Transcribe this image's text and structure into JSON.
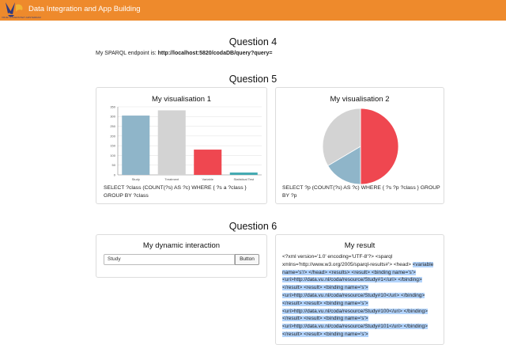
{
  "header": {
    "title": "Data Integration and App Building",
    "logo_caption": "VRIJE UNIVERSITEIT AMSTERDAM"
  },
  "q4": {
    "heading": "Question 4",
    "endpoint_label": "My SPARQL endpoint is:",
    "endpoint_url": "http://localhost:5820/codaDB/query?query="
  },
  "q5": {
    "heading": "Question 5",
    "vis1": {
      "title": "My visualisation 1",
      "query": "SELECT ?class (COUNT(?s) AS ?c) WHERE { ?s a ?class } GROUP BY ?class"
    },
    "vis2": {
      "title": "My visualisation 2",
      "query": "SELECT ?p (COUNT(?s) AS ?c) WHERE { ?s ?p ?class } GROUP BY ?p"
    }
  },
  "q6": {
    "heading": "Question 6",
    "interaction": {
      "title": "My dynamic interaction",
      "input_value": "Study",
      "button_label": "Button"
    },
    "result": {
      "title": "My result",
      "text_plain": "<?xml version='1.0' encoding='UTF-8'?> <sparql xmlns='http://www.w3.org/2005/sparql-results#'> <head> ",
      "text_selected": "<variable name='s'/> </head> <results> <result> <binding name='s'> <uri>http://data.vu.nl/coda/resource/Study#1</uri> </binding> </result> <result> <binding name='s'> <uri>http://data.vu.nl/coda/resource/Study#10</uri> </binding> </result> <result> <binding name='s'> <uri>http://data.vu.nl/coda/resource/Study#100</uri> </binding> </result> <result> <binding name='s'> <uri>http://data.vu.nl/coda/resource/Study#101</uri> </binding> </result> <result> <binding name='s'>"
    }
  },
  "chart_data": [
    {
      "type": "bar",
      "categories": [
        "Study",
        "Treatment",
        "Variable",
        "Statistical Test"
      ],
      "values": [
        305,
        332,
        130,
        12
      ],
      "colors": [
        "#8fb5c9",
        "#d3d3d3",
        "#ef4750",
        "#42a9b1"
      ],
      "ylim": [
        0,
        350
      ],
      "yticks": [
        "0",
        "50",
        "100",
        "150",
        "200",
        "250",
        "300",
        "350"
      ],
      "grid": true
    },
    {
      "type": "pie",
      "slices": [
        {
          "value": 50.0,
          "color": "#ef4750"
        },
        {
          "value": 16.5,
          "color": "#8fb5c9"
        },
        {
          "value": 33.5,
          "color": "#d3d3d3"
        }
      ]
    }
  ]
}
